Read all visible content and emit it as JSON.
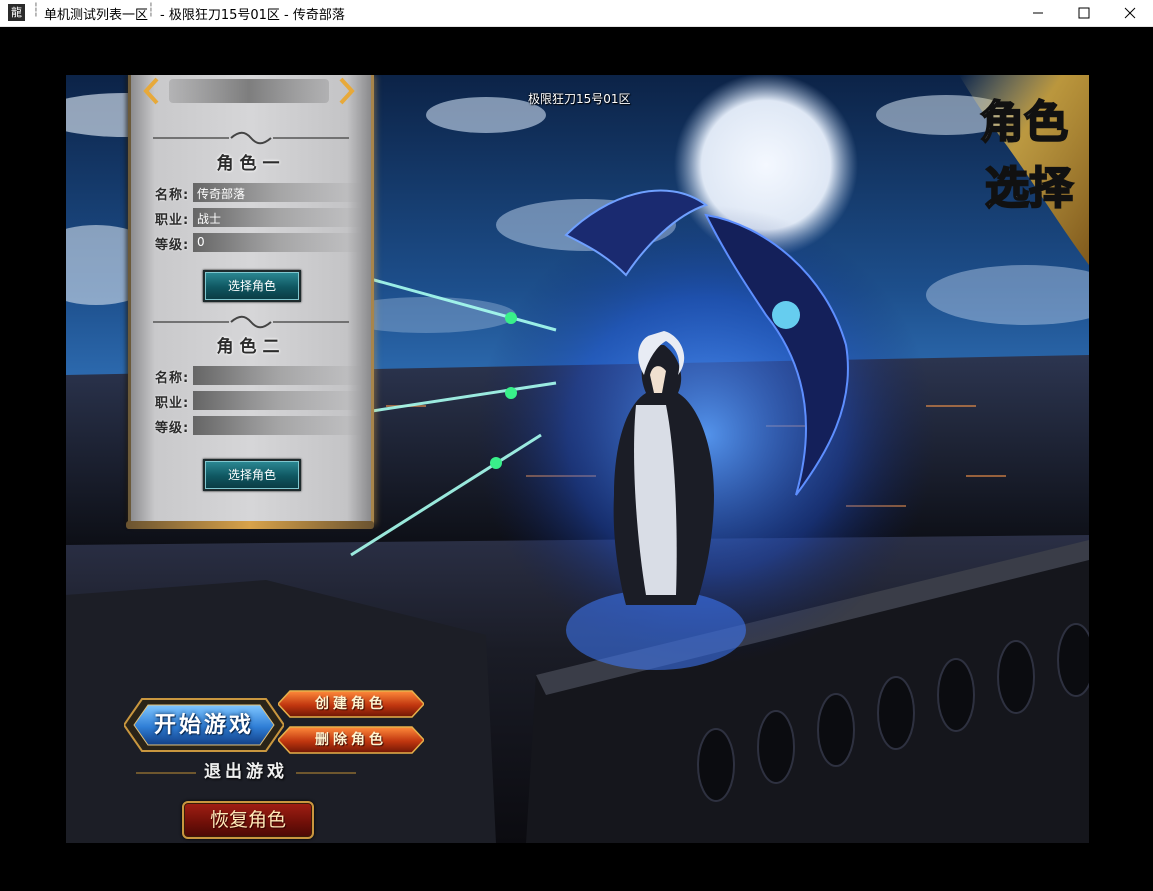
{
  "window": {
    "title_part1": "单机测试列表一区",
    "title_part2": "- 极限狂刀15号01区 - 传奇部落",
    "icon_glyph": "龍"
  },
  "game": {
    "zone_label": "极限狂刀15号01区",
    "logo_text_line1": "角色",
    "logo_text_line2": "选择",
    "role1": {
      "title": "角色一",
      "name_key": "名称:",
      "name_val": "传奇部落",
      "job_key": "职业:",
      "job_val": "战士",
      "level_key": "等级:",
      "level_val": "0",
      "select_label": "选择角色"
    },
    "role2": {
      "title": "角色二",
      "name_key": "名称:",
      "name_val": "",
      "job_key": "职业:",
      "job_val": "",
      "level_key": "等级:",
      "level_val": "",
      "select_label": "选择角色"
    },
    "buttons": {
      "start": "开始游戏",
      "create": "创建角色",
      "delete": "删除角色",
      "exit": "退出游戏",
      "restore": "恢复角色"
    }
  },
  "colors": {
    "teal_button": "#0f5660",
    "red_button": "#c0360f",
    "gold_trim": "#d8a24a"
  }
}
